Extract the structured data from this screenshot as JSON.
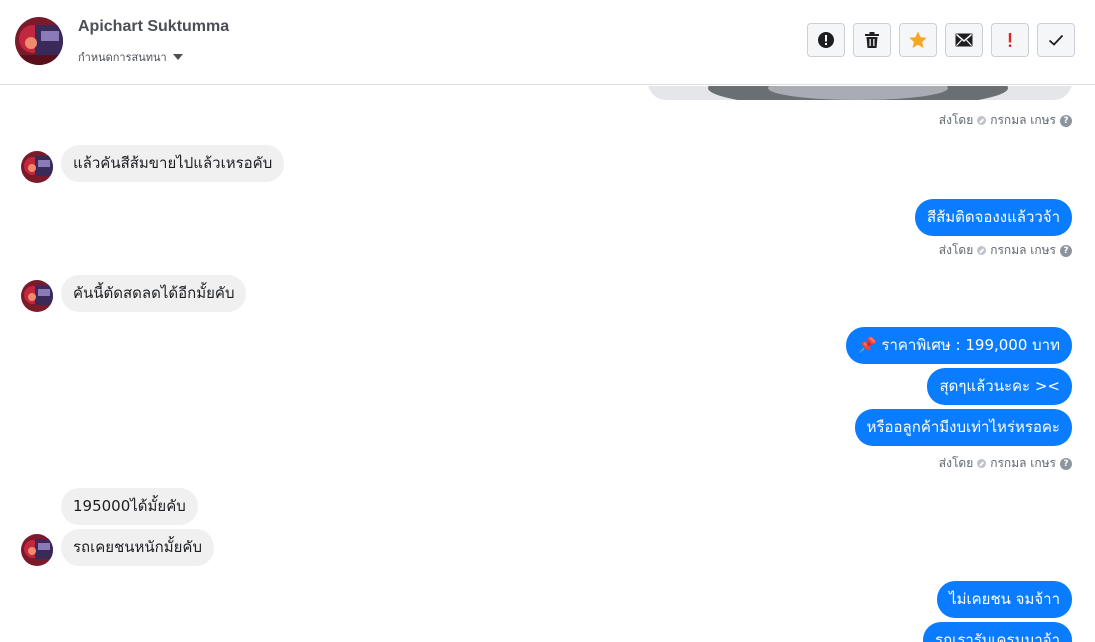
{
  "header": {
    "name": "Apichart Suktumma",
    "subtitle": "กำหนดการสนทนา",
    "actions": [
      {
        "name": "report-button",
        "icon": "alert-circle-icon"
      },
      {
        "name": "delete-button",
        "icon": "trash-icon"
      },
      {
        "name": "star-button",
        "icon": "star-icon"
      },
      {
        "name": "mail-button",
        "icon": "envelope-icon"
      },
      {
        "name": "mark-important-button",
        "icon": "exclamation-icon"
      },
      {
        "name": "mark-done-button",
        "icon": "check-icon"
      }
    ]
  },
  "colors": {
    "outgoing_bubble": "#0a7cff",
    "incoming_bubble": "#f0f0f0",
    "star": "#f5a623",
    "important": "#e02424"
  },
  "sent_by": {
    "prefix": "ส่งโดย",
    "agent": "กรกมล เกษร"
  },
  "messages": {
    "m1": "แล้วคันสีส้มขายไปแล้วเหรอคับ",
    "m2": "สีส้มติดจองงแล้ววจ้า",
    "m3": "คันนี้ตัดสดลดได้อีกมั้ยคับ",
    "m4_icon": "📌",
    "m4": "ราคาพิเศษ : 199,000 บาท",
    "m5": "สุดๆแล้วนะคะ ><",
    "m6": "หรืออลูกค้ามีงบเท่าไหร่หรอคะ",
    "m7": "195000ได้มั้ยคับ",
    "m8": "รถเคยชนหนักมั้ยคับ",
    "m9": "ไม่เคยชน จมจ้าา",
    "m10": "รถเรารับเครมมาจ้า"
  }
}
